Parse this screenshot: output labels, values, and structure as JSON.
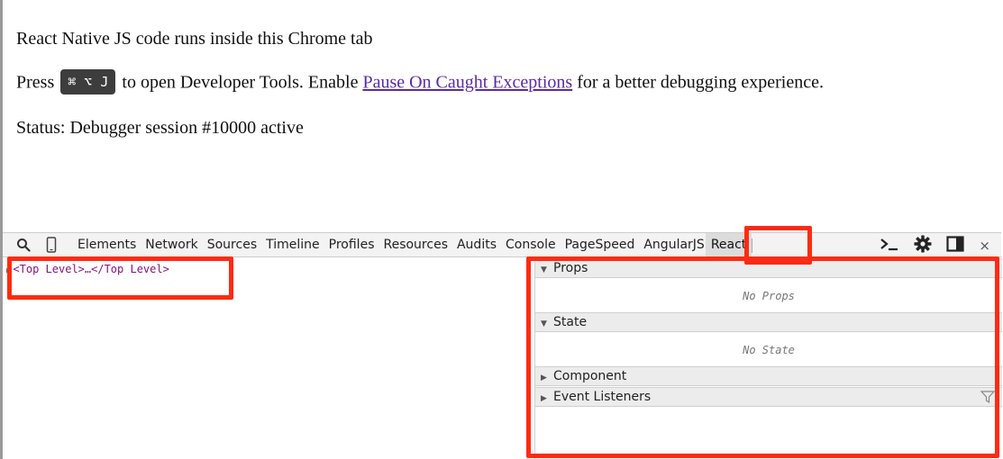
{
  "page": {
    "line1": "React Native JS code runs inside this Chrome tab",
    "line2_prefix": "Press",
    "shortcut": "⌘ ⌥ J",
    "line2_middle": "to open Developer Tools. Enable",
    "link_text": "Pause On Caught Exceptions",
    "line2_suffix": "for a better debugging experience.",
    "status": "Status: Debugger session #10000 active"
  },
  "devtools": {
    "tabs": [
      {
        "label": "Elements"
      },
      {
        "label": "Network"
      },
      {
        "label": "Sources"
      },
      {
        "label": "Timeline"
      },
      {
        "label": "Profiles"
      },
      {
        "label": "Resources"
      },
      {
        "label": "Audits"
      },
      {
        "label": "Console"
      },
      {
        "label": "PageSpeed"
      },
      {
        "label": "AngularJS"
      },
      {
        "label": "React"
      }
    ],
    "active_tab": "React",
    "close_glyph": "×",
    "tree_node": "<Top Level>…</Top Level>",
    "sections": {
      "props_title": "Props",
      "props_empty": "No Props",
      "state_title": "State",
      "state_empty": "No State",
      "component_title": "Component",
      "event_listeners_title": "Event Listeners"
    }
  },
  "colors": {
    "highlight": "#ff2a13",
    "link": "#5a2aa8",
    "tag": "#881280"
  },
  "icons": [
    "search-icon",
    "device-mode-icon",
    "console-drawer-icon",
    "settings-gear-icon",
    "dock-side-icon",
    "close-icon",
    "filter-icon",
    "expand-triangle-icon",
    "collapse-triangle-icon"
  ]
}
